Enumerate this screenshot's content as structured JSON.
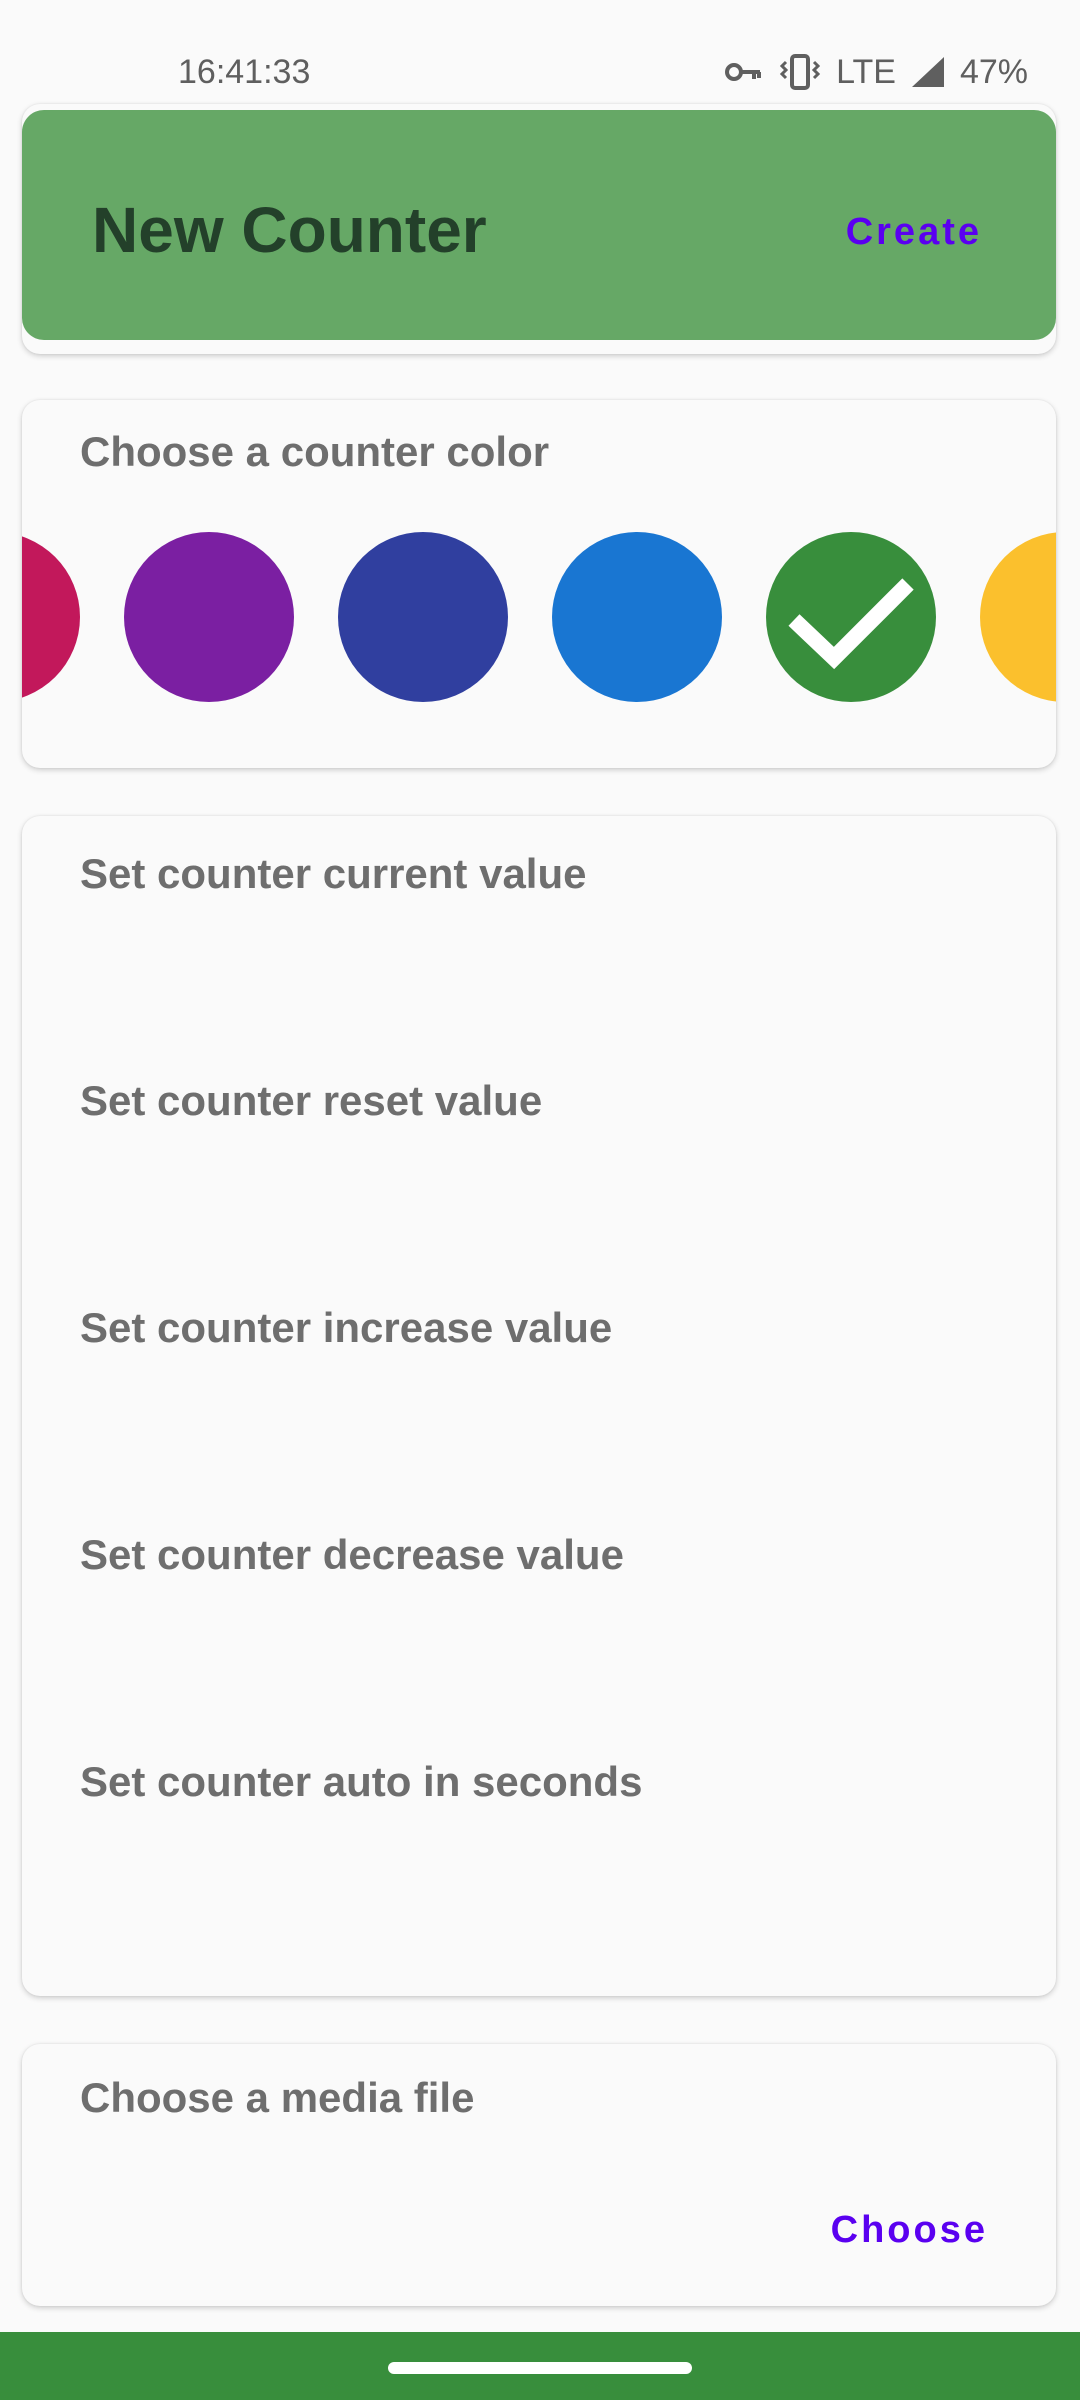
{
  "status_bar": {
    "time": "16:41:33",
    "network": "LTE",
    "battery": "47%",
    "icons": [
      "vpn-key-icon",
      "vibrate-icon",
      "signal-icon"
    ]
  },
  "header": {
    "title": "New Counter",
    "create_label": "Create",
    "background_color": "#66a866"
  },
  "color_picker": {
    "label": "Choose a counter color",
    "swatches": [
      {
        "color": "#c2185b",
        "selected": false
      },
      {
        "color": "#7b1fa2",
        "selected": false
      },
      {
        "color": "#303f9f",
        "selected": false
      },
      {
        "color": "#1976d2",
        "selected": false
      },
      {
        "color": "#388e3c",
        "selected": true
      },
      {
        "color": "#fbc02d",
        "selected": false
      }
    ],
    "selected_icon": "check-icon"
  },
  "values": {
    "current_label": "Set counter current value",
    "reset_label": "Set counter reset value",
    "increase_label": "Set counter increase value",
    "decrease_label": "Set counter decrease value",
    "auto_label": "Set counter auto in seconds"
  },
  "media": {
    "label": "Choose a media file",
    "choose_label": "Choose"
  },
  "accent_color": "#5a00f0",
  "nav_bar_color": "#388e3c"
}
